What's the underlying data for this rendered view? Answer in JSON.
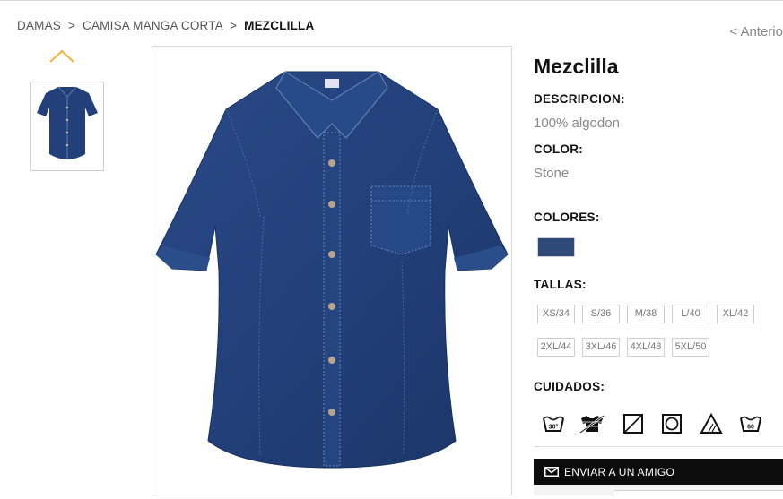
{
  "breadcrumb": {
    "items": [
      "DAMAS",
      "CAMISA MANGA CORTA"
    ],
    "current": "MEZCLILLA",
    "separator": ">"
  },
  "nav": {
    "prev_label": "< Anterio"
  },
  "product": {
    "title": "Mezclilla",
    "description_label": "DESCRIPCION:",
    "description": "100% algodon",
    "color_label": "COLOR:",
    "color": "Stone",
    "colors_label": "COLORES:",
    "colors": [
      {
        "hex": "#2e4a78"
      }
    ],
    "sizes_label": "TALLAS:",
    "sizes": [
      "XS/34",
      "S/36",
      "M/38",
      "L/40",
      "XL/42",
      "2XL/44",
      "3XL/46",
      "4XL/48",
      "5XL/50"
    ],
    "care_label": "CUIDADOS:",
    "care_icons": [
      "wash-30-icon",
      "no-tumble-dry-icon",
      "drip-dry-icon",
      "dry-clean-icon",
      "bleach-icon",
      "wash-60-icon"
    ],
    "care_text": {
      "wash30": "30°",
      "wash60": "60"
    }
  },
  "actions": {
    "send_friend_label": "ENVIAR A UN AMIGO"
  },
  "colors": {
    "accent": "#f3b43b",
    "denim": "#23407a",
    "button_bg": "#0c0c0c"
  }
}
